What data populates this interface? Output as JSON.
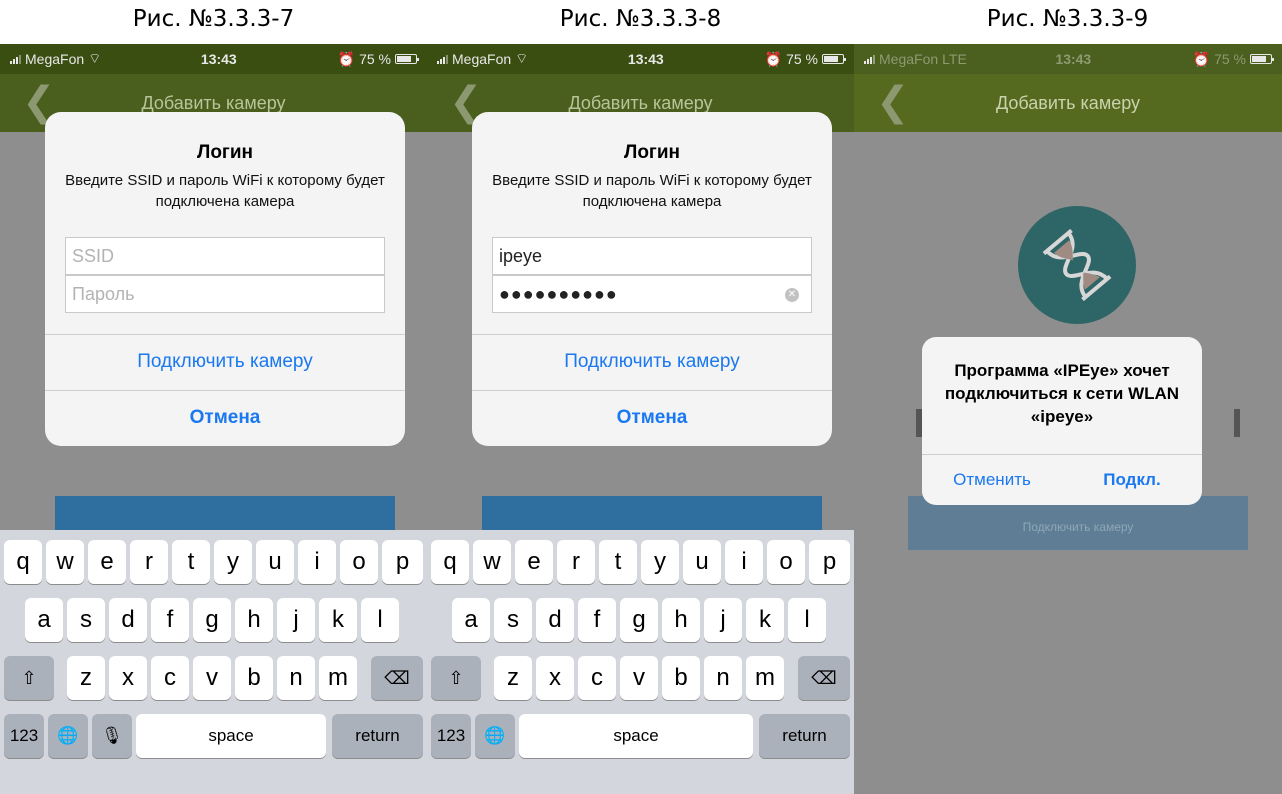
{
  "captions": [
    "Рис. №3.3.3-7",
    "Рис. №3.3.3-8",
    "Рис. №3.3.3-9"
  ],
  "status": {
    "carrier": "MegaFon",
    "network_3": "LTE",
    "time": "13:43",
    "battery": "75 %"
  },
  "nav": {
    "title": "Добавить камеру",
    "back_glyph": "❮"
  },
  "dialog": {
    "title": "Логин",
    "message": "Введите SSID и пароль WiFi к которому будет подключена камера",
    "ssid_placeholder": "SSID",
    "password_placeholder": "Пароль",
    "ssid_value": "ipeye",
    "password_mask": "●●●●●●●●●●",
    "connect_label": "Подключить камеру",
    "cancel_label": "Отмена"
  },
  "keyboard": {
    "row1": [
      "q",
      "w",
      "e",
      "r",
      "t",
      "y",
      "u",
      "i",
      "o",
      "p"
    ],
    "row2": [
      "a",
      "s",
      "d",
      "f",
      "g",
      "h",
      "j",
      "k",
      "l"
    ],
    "row3": [
      "z",
      "x",
      "c",
      "v",
      "b",
      "n",
      "m"
    ],
    "shift": "⇧",
    "backspace": "⌫",
    "numbers": "123",
    "globe": "🌐",
    "mic": "🎙",
    "space": "space",
    "return": "return"
  },
  "alert": {
    "message": "Программа «IPEye» хочет подключиться к сети WLAN «ipeye»",
    "cancel": "Отменить",
    "connect": "Подкл."
  },
  "screen3": {
    "connect_bar": "Подключить камеру"
  },
  "colors": {
    "header": "#4a5f1e",
    "link": "#1a78f0",
    "spinner": "#2e6567"
  },
  "icons": [
    "wifi-icon",
    "alarm-icon",
    "battery-icon",
    "back-chevron-icon",
    "hourglass-icon",
    "clear-icon"
  ]
}
